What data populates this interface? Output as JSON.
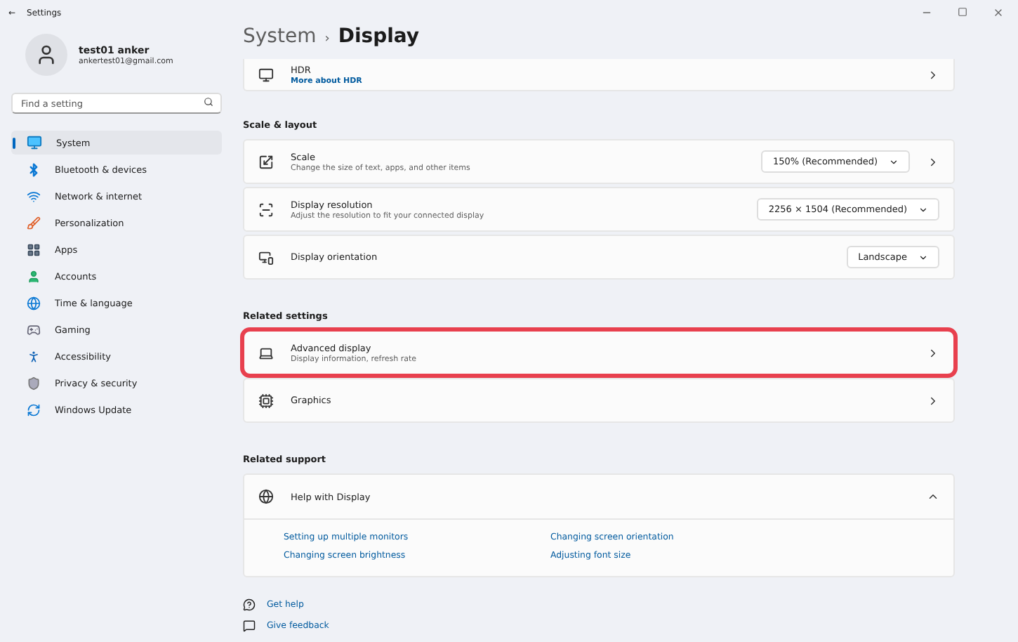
{
  "window": {
    "title": "Settings",
    "back": "←"
  },
  "profile": {
    "name": "test01 anker",
    "email": "ankertest01@gmail.com"
  },
  "search": {
    "placeholder": "Find a setting"
  },
  "sidebar": {
    "items": [
      {
        "label": "System",
        "selected": true
      },
      {
        "label": "Bluetooth & devices",
        "selected": false
      },
      {
        "label": "Network & internet",
        "selected": false
      },
      {
        "label": "Personalization",
        "selected": false
      },
      {
        "label": "Apps",
        "selected": false
      },
      {
        "label": "Accounts",
        "selected": false
      },
      {
        "label": "Time & language",
        "selected": false
      },
      {
        "label": "Gaming",
        "selected": false
      },
      {
        "label": "Accessibility",
        "selected": false
      },
      {
        "label": "Privacy & security",
        "selected": false
      },
      {
        "label": "Windows Update",
        "selected": false
      }
    ]
  },
  "breadcrumb": {
    "parent": "System",
    "separator": "›",
    "current": "Display"
  },
  "hdr": {
    "title": "HDR",
    "link": "More about HDR"
  },
  "sections": [
    {
      "heading": "Scale & layout",
      "rows": [
        {
          "title": "Scale",
          "subtitle": "Change the size of text, apps, and other items",
          "dropdown": "150% (Recommended)",
          "chevron": true,
          "highlighted": false
        },
        {
          "title": "Display resolution",
          "subtitle": "Adjust the resolution to fit your connected display",
          "dropdown": "2256 × 1504 (Recommended)",
          "chevron": false,
          "highlighted": false
        },
        {
          "title": "Display orientation",
          "dropdown": "Landscape",
          "chevron": false,
          "highlighted": false
        }
      ]
    },
    {
      "heading": "Related settings",
      "rows": [
        {
          "title": "Advanced display",
          "subtitle": "Display information, refresh rate",
          "chevron": true,
          "highlighted": true
        },
        {
          "title": "Graphics",
          "chevron": true,
          "highlighted": false
        }
      ]
    }
  ],
  "support": {
    "heading": "Related support",
    "title": "Help with Display",
    "expanded": true,
    "links": [
      "Setting up multiple monitors",
      "Changing screen orientation",
      "Changing screen brightness",
      "Adjusting font size"
    ]
  },
  "footer_links": [
    {
      "label": "Get help"
    },
    {
      "label": "Give feedback"
    }
  ]
}
